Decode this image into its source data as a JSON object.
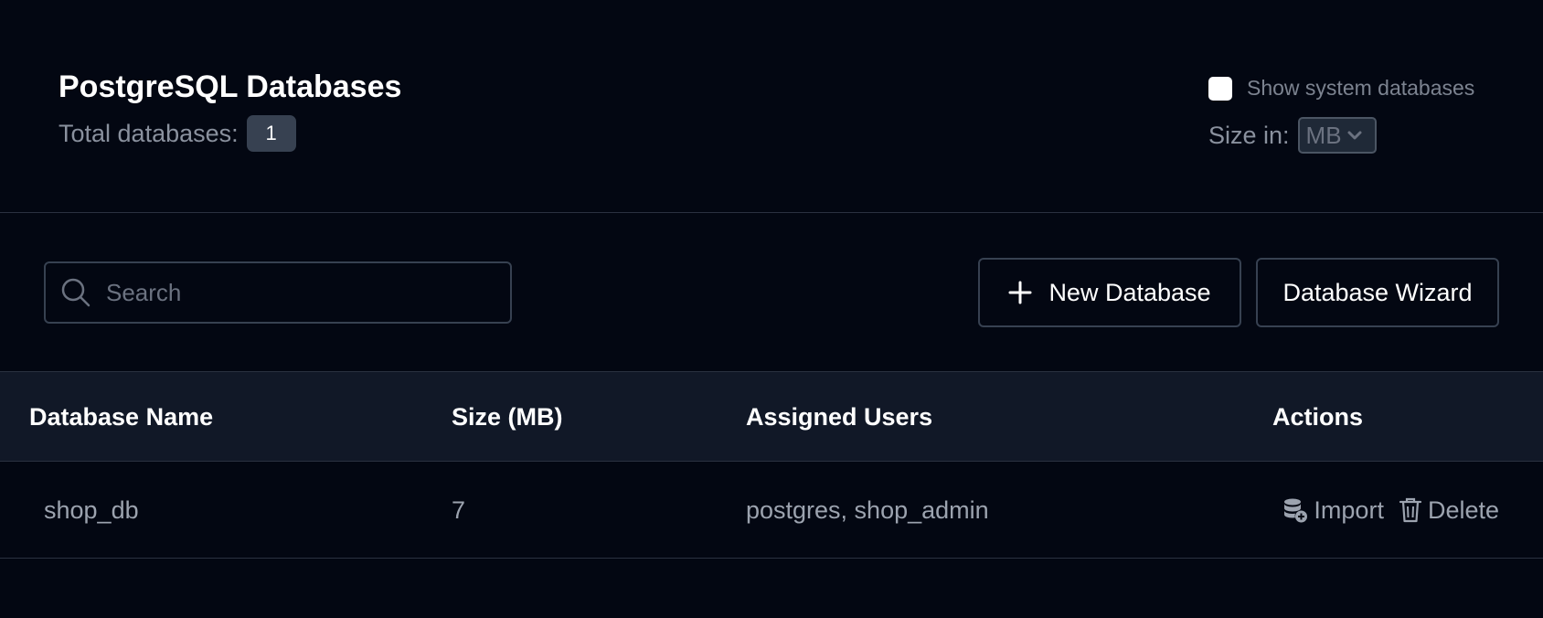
{
  "header": {
    "title": "PostgreSQL Databases",
    "total_label": "Total databases:",
    "total_count": "1",
    "show_system_label": "Show system databases",
    "show_system_checked": false,
    "size_in_label": "Size in:",
    "size_unit": "MB"
  },
  "toolbar": {
    "search_placeholder": "Search",
    "new_database_label": "New Database",
    "wizard_label": "Database Wizard"
  },
  "table": {
    "columns": [
      "Database Name",
      "Size (MB)",
      "Assigned Users",
      "Actions"
    ],
    "rows": [
      {
        "name": "shop_db",
        "size": "7",
        "users": "postgres, shop_admin",
        "import_label": "Import",
        "delete_label": "Delete"
      }
    ]
  },
  "icons": {
    "search": "search-icon",
    "plus": "plus-icon",
    "chevron": "chevron-down-icon",
    "import": "database-import-icon",
    "delete": "trash-icon"
  },
  "colors": {
    "background": "#030712",
    "table_header_bg": "#111827",
    "badge_bg": "#374151",
    "muted_text": "#9ca3af"
  }
}
